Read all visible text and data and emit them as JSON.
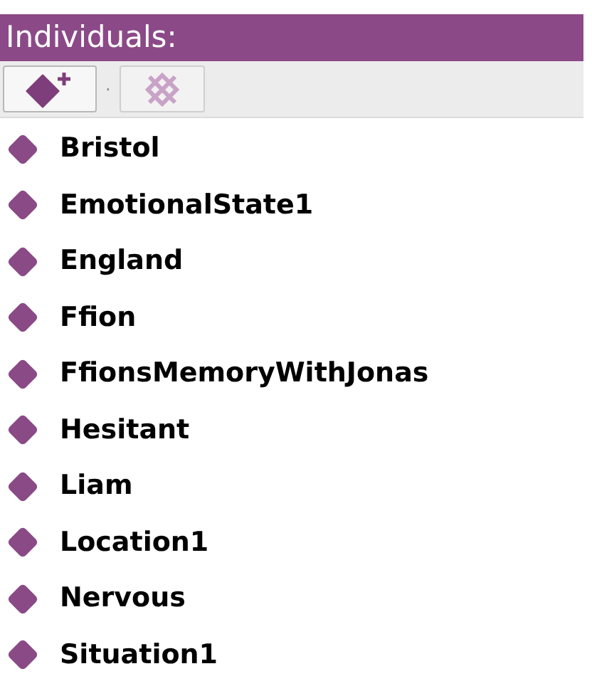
{
  "panel": {
    "title": "Individuals:"
  },
  "toolbar": {
    "separator": "·"
  },
  "individuals": [
    {
      "name": "Bristol"
    },
    {
      "name": "EmotionalState1"
    },
    {
      "name": "England"
    },
    {
      "name": "Ffion"
    },
    {
      "name": "FfionsMemoryWithJonas"
    },
    {
      "name": "Hesitant"
    },
    {
      "name": "Liam"
    },
    {
      "name": "Location1"
    },
    {
      "name": "Nervous"
    },
    {
      "name": "Situation1"
    }
  ]
}
